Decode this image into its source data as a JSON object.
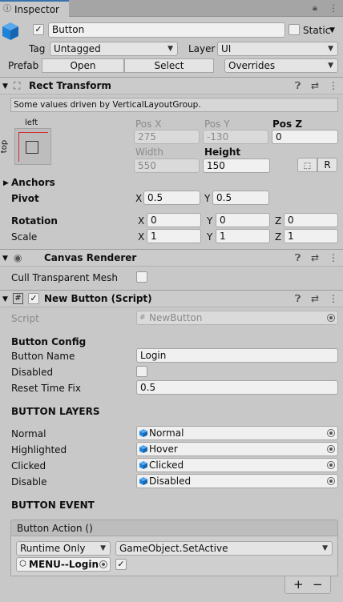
{
  "tab": {
    "title": "Inspector"
  },
  "object": {
    "name": "Button",
    "static_label": "Static",
    "tag_label": "Tag",
    "tag_value": "Untagged",
    "layer_label": "Layer",
    "layer_value": "UI",
    "prefab_label": "Prefab",
    "open_label": "Open",
    "select_label": "Select",
    "overrides_label": "Overrides"
  },
  "rect_transform": {
    "title": "Rect Transform",
    "info": "Some values driven by VerticalLayoutGroup.",
    "anchor_h": "left",
    "anchor_v": "top",
    "posx_label": "Pos X",
    "posx_value": "275",
    "posy_label": "Pos Y",
    "posy_value": "-130",
    "posz_label": "Pos Z",
    "posz_value": "0",
    "width_label": "Width",
    "width_value": "550",
    "height_label": "Height",
    "height_value": "150",
    "r_button": "R",
    "anchors_label": "Anchors",
    "pivot_label": "Pivot",
    "pivot_x": "0.5",
    "pivot_y": "0.5",
    "rotation_label": "Rotation",
    "rot_x": "0",
    "rot_y": "0",
    "rot_z": "0",
    "scale_label": "Scale",
    "scale_x": "1",
    "scale_y": "1",
    "scale_z": "1",
    "x": "X",
    "y": "Y",
    "z": "Z"
  },
  "canvas_renderer": {
    "title": "Canvas Renderer",
    "cull_label": "Cull Transparent Mesh"
  },
  "script": {
    "title": "New Button (Script)",
    "script_label": "Script",
    "script_value": "NewButton",
    "config_header": "Button Config",
    "name_label": "Button Name",
    "name_value": "Login",
    "disabled_label": "Disabled",
    "reset_label": "Reset Time Fix",
    "reset_value": "0.5",
    "layers_header": "BUTTON LAYERS",
    "layers": [
      {
        "label": "Normal",
        "value": "Normal"
      },
      {
        "label": "Highlighted",
        "value": "Hover"
      },
      {
        "label": "Clicked",
        "value": "Clicked"
      },
      {
        "label": "Disable",
        "value": "Disabled"
      }
    ],
    "event_header": "BUTTON EVENT",
    "event_title": "Button Action ()",
    "runtime_value": "Runtime Only",
    "function_value": "GameObject.SetActive",
    "target_value": "MENU--Login",
    "plus": "+",
    "minus": "−"
  },
  "colors": {
    "accent_blue": "#1d83d8",
    "panel": "#c8c8c8",
    "field": "#f0f0f0"
  }
}
